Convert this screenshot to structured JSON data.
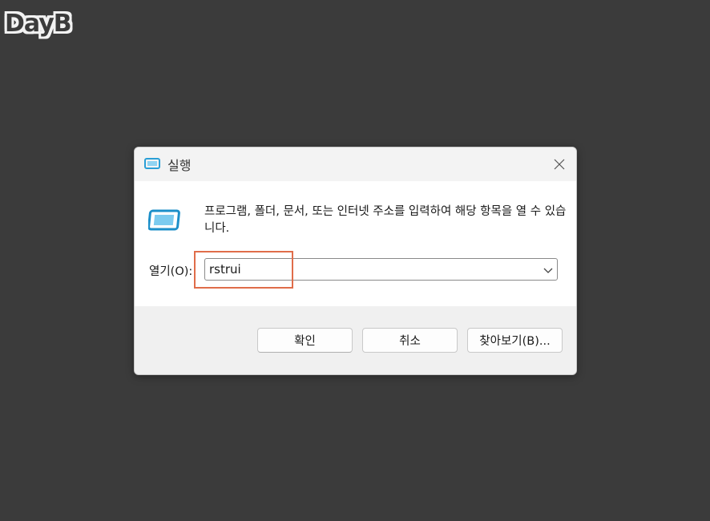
{
  "watermark": {
    "text": "DayB"
  },
  "dialog": {
    "title": "실행",
    "close_icon": "close-icon",
    "app_icon": "run-window-icon",
    "description": "프로그램, 폴더, 문서, 또는 인터넷 주소를 입력하여 해당 항목을 열 수 있습니다.",
    "open_label": "열기(O):",
    "open_value": "rstrui",
    "ok_label": "확인",
    "cancel_label": "취소",
    "browse_label": "찾아보기(B)..."
  },
  "colors": {
    "background": "#3b3b3b",
    "dialog_bg": "#ffffff",
    "footer_bg": "#f0f0f0",
    "highlight": "#e06d4a",
    "icon_accent": "#2a9fd6"
  }
}
